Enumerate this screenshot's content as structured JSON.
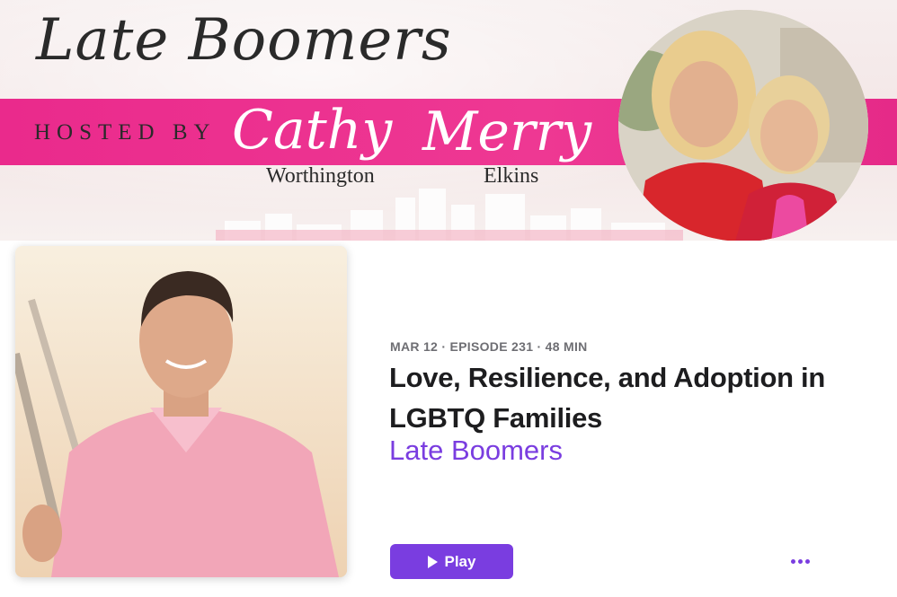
{
  "banner": {
    "show_title": "Late Boomers",
    "hosted_by": "HOSTED BY",
    "host1_first": "Cathy",
    "host1_last": "Worthington",
    "host2_first": "Merry",
    "host2_last": "Elkins",
    "band_color": "#ea2a8c"
  },
  "episode": {
    "meta": "MAR 12 · EPISODE 231 · 48 MIN",
    "title": "Love, Resilience, and Adoption in LGBTQ Families",
    "show_name": "Late Boomers",
    "play_label": "Play",
    "accent_color": "#7a3de0"
  },
  "icons": {
    "play": "play-icon",
    "more": "more-options-icon"
  }
}
